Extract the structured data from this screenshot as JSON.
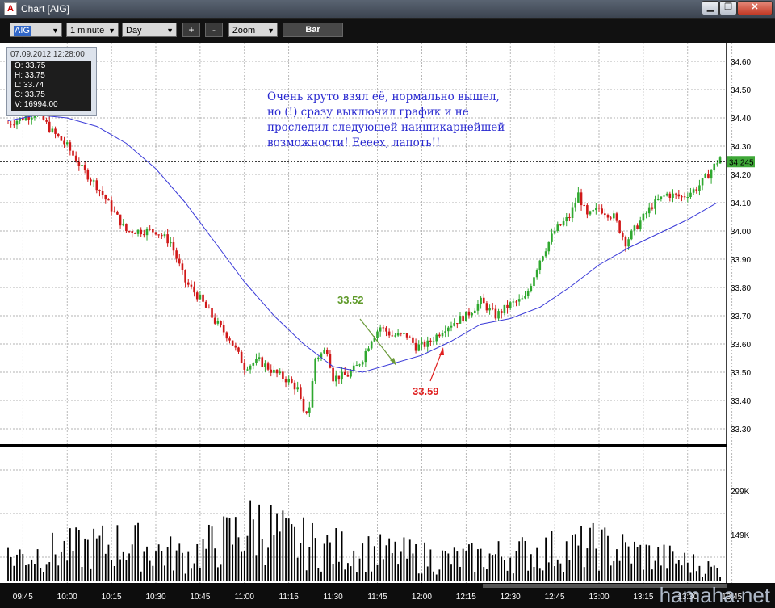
{
  "window": {
    "title": "Chart [AIG]",
    "app_icon_letter": "A",
    "minimize_glyph": "▁",
    "restore_glyph": "❐",
    "close_glyph": "✕"
  },
  "toolbar": {
    "symbol": "AIG",
    "interval": "1 minute",
    "period": "Day",
    "zoom_in": "+",
    "zoom_out": "-",
    "zoom": "Zoom",
    "chart_type": "Bar"
  },
  "info": {
    "datetime": "07.09.2012 12:28:00",
    "open": "O: 33.75",
    "high": "H: 33.75",
    "low": "L: 33.74",
    "close": "C: 33.75",
    "volume": "V: 16994.00"
  },
  "note": {
    "line1": "Очень круто взял её, нормально вышел,",
    "line2": "но (!) сразу выключил график и не",
    "line3": "проследил следующей наишикарнейшей",
    "line4": "возможности! Ееееx, лапоть!!"
  },
  "annotations": {
    "green_label": "33.52",
    "red_label": "33.59"
  },
  "colors": {
    "up": "#2fa82f",
    "down": "#d01818",
    "ma": "#3b3bd8",
    "grid": "#9a9a9a",
    "green_label": "#5f9a2a",
    "red_label": "#e02020",
    "last_price_bg": "#3fa838"
  },
  "price_axis": [
    "34.60",
    "34.50",
    "34.40",
    "34.30",
    "34.20",
    "34.10",
    "34.00",
    "33.90",
    "33.80",
    "33.70",
    "33.60",
    "33.50",
    "33.40",
    "33.30"
  ],
  "last_price": "34.245",
  "volume_axis": [
    "299K",
    "149K"
  ],
  "time_axis": [
    "09:45",
    "10:00",
    "10:15",
    "10:30",
    "10:45",
    "11:00",
    "11:15",
    "11:30",
    "11:45",
    "12:00",
    "12:15",
    "12:30",
    "12:45",
    "13:00",
    "13:15",
    "13:30",
    "13:45"
  ],
  "watermark": "hamaha.net",
  "chart_data": {
    "type": "candlestick",
    "symbol": "AIG",
    "interval": "1 minute",
    "x_range": [
      "09:40",
      "13:48"
    ],
    "ylim": [
      33.22,
      34.66
    ],
    "volume_ylim": [
      0,
      420000
    ],
    "moving_average": [
      [
        0,
        34.39
      ],
      [
        10,
        34.41
      ],
      [
        20,
        34.4
      ],
      [
        30,
        34.37
      ],
      [
        40,
        34.31
      ],
      [
        50,
        34.22
      ],
      [
        60,
        34.1
      ],
      [
        70,
        33.96
      ],
      [
        80,
        33.82
      ],
      [
        90,
        33.7
      ],
      [
        100,
        33.6
      ],
      [
        110,
        33.52
      ],
      [
        120,
        33.5
      ],
      [
        130,
        33.53
      ],
      [
        140,
        33.56
      ],
      [
        150,
        33.61
      ],
      [
        160,
        33.67
      ],
      [
        170,
        33.69
      ],
      [
        180,
        33.73
      ],
      [
        190,
        33.8
      ],
      [
        200,
        33.88
      ],
      [
        210,
        33.94
      ],
      [
        220,
        33.99
      ],
      [
        230,
        34.04
      ],
      [
        240,
        34.1
      ]
    ],
    "price_path": [
      [
        0,
        34.38
      ],
      [
        5,
        34.4
      ],
      [
        10,
        34.42
      ],
      [
        15,
        34.35
      ],
      [
        20,
        34.3
      ],
      [
        25,
        34.22
      ],
      [
        30,
        34.16
      ],
      [
        35,
        34.08
      ],
      [
        40,
        34.0
      ],
      [
        45,
        34.0
      ],
      [
        50,
        34.0
      ],
      [
        55,
        33.96
      ],
      [
        60,
        33.82
      ],
      [
        65,
        33.76
      ],
      [
        70,
        33.68
      ],
      [
        75,
        33.62
      ],
      [
        80,
        33.52
      ],
      [
        85,
        33.54
      ],
      [
        90,
        33.5
      ],
      [
        95,
        33.47
      ],
      [
        98,
        33.44
      ],
      [
        100,
        33.35
      ],
      [
        102,
        33.38
      ],
      [
        104,
        33.55
      ],
      [
        108,
        33.58
      ],
      [
        110,
        33.48
      ],
      [
        115,
        33.49
      ],
      [
        118,
        33.52
      ],
      [
        120,
        33.55
      ],
      [
        123,
        33.62
      ],
      [
        126,
        33.66
      ],
      [
        130,
        33.63
      ],
      [
        135,
        33.63
      ],
      [
        138,
        33.59
      ],
      [
        142,
        33.6
      ],
      [
        148,
        33.66
      ],
      [
        155,
        33.7
      ],
      [
        160,
        33.75
      ],
      [
        165,
        33.7
      ],
      [
        170,
        33.74
      ],
      [
        175,
        33.76
      ],
      [
        180,
        33.9
      ],
      [
        185,
        34.0
      ],
      [
        190,
        34.05
      ],
      [
        193,
        34.13
      ],
      [
        196,
        34.05
      ],
      [
        200,
        34.08
      ],
      [
        205,
        34.05
      ],
      [
        209,
        33.96
      ],
      [
        213,
        34.02
      ],
      [
        218,
        34.09
      ],
      [
        223,
        34.13
      ],
      [
        228,
        34.12
      ],
      [
        233,
        34.15
      ],
      [
        237,
        34.2
      ],
      [
        241,
        34.26
      ]
    ],
    "volume_peaks_k": [
      [
        0,
        90
      ],
      [
        40,
        140
      ],
      [
        60,
        90
      ],
      [
        75,
        160
      ],
      [
        85,
        210
      ],
      [
        95,
        150
      ],
      [
        110,
        120
      ],
      [
        150,
        80
      ],
      [
        200,
        130
      ],
      [
        230,
        70
      ],
      [
        241,
        40
      ]
    ],
    "annotations": [
      {
        "label": "33.52",
        "price": 33.52,
        "time": "11:45"
      },
      {
        "label": "33.59",
        "price": 33.59,
        "time": "12:05"
      }
    ],
    "last_price": 34.245
  }
}
